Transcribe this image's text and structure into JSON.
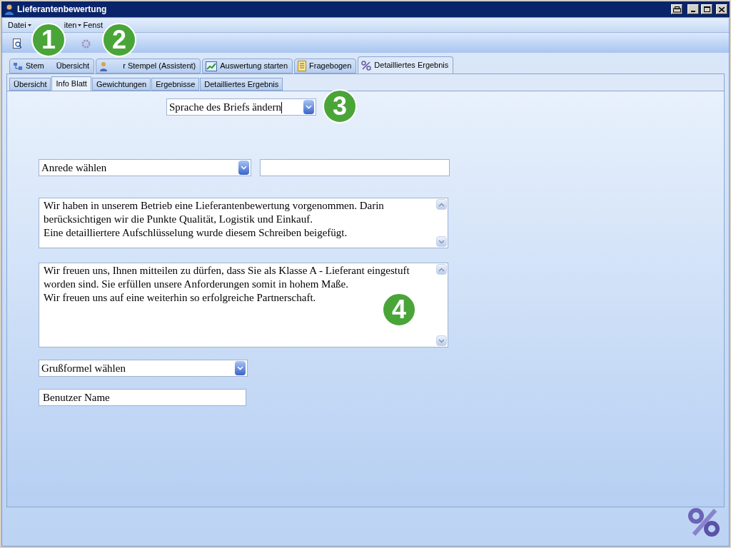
{
  "window": {
    "title": "Lieferantenbewertung"
  },
  "menu": [
    {
      "label": "Datei",
      "caret": true
    },
    {
      "label": "iten",
      "caret": true
    },
    {
      "label": "Fenst",
      "caret": false
    }
  ],
  "main_tabs": [
    {
      "label_parts": [
        "Stem",
        "Übersicht"
      ],
      "selected": false
    },
    {
      "label": "r Stempel (Assistent)",
      "selected": false
    },
    {
      "label": "Auswertung starten",
      "selected": false
    },
    {
      "label": "Fragebogen",
      "selected": false
    },
    {
      "label": "Detailliertes Ergebnis",
      "selected": true
    }
  ],
  "sub_tabs": [
    {
      "label": "Übersicht",
      "selected": false
    },
    {
      "label": "Info Blatt",
      "selected": true
    },
    {
      "label": "Gewichtungen",
      "selected": false
    },
    {
      "label": "Ergebnisse",
      "selected": false
    },
    {
      "label": "Detailliertes Ergebnis",
      "selected": false
    }
  ],
  "language_select": {
    "value": "Sprache des Briefs ändern"
  },
  "salutation_select": {
    "value": "Anrede wählen"
  },
  "text_1": [
    "Wir haben in unserem Betrieb eine Lieferantenbewertung vorgenommen. Darin berücksichtigen wir die Punkte Qualität, Logistik und Einkauf.",
    "Eine detailliertere Aufschlüsselung wurde diesem Schreiben beigefügt."
  ],
  "text_2": [
    "Wir freuen uns, Ihnen mitteilen zu dürfen, dass Sie als Klasse A - Lieferant eingestuft worden sind. Sie erfüllen unsere Anforderungen somit in hohem Maße.",
    "Wir freuen uns auf eine weiterhin so erfolgreiche Partnerschaft."
  ],
  "closing_select": {
    "value": "Grußformel wählen"
  },
  "user_name": {
    "value": "Benutzer Name"
  },
  "callouts": [
    "1",
    "2",
    "3",
    "4"
  ]
}
